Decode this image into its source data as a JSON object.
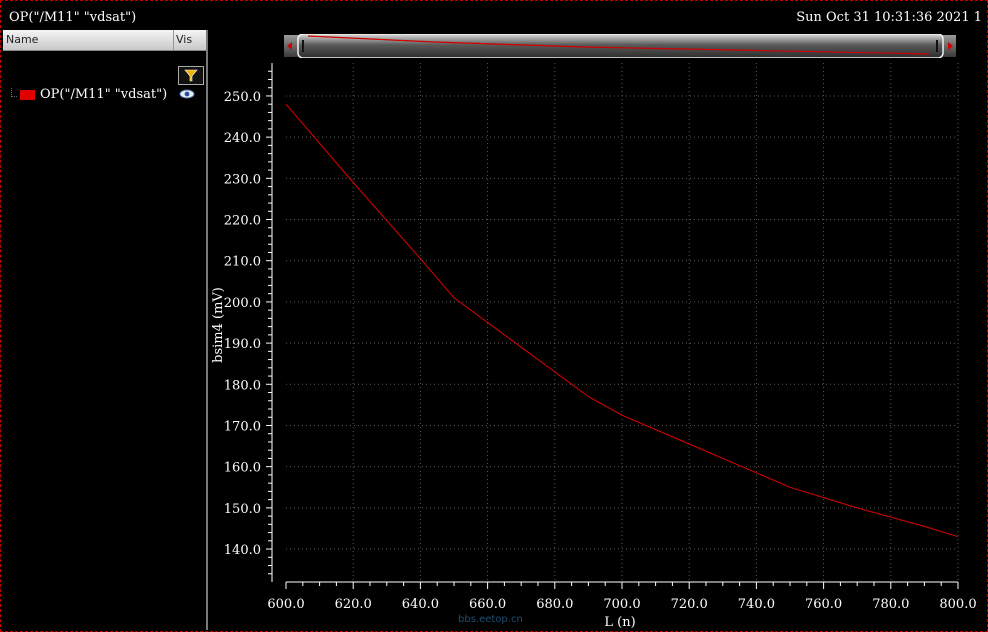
{
  "window": {
    "title": "OP(\"/M11\" \"vdsat\")",
    "datetime": "Sun Oct 31 10:31:36 2021  1"
  },
  "panel": {
    "col_name": "Name",
    "col_vis": "Vis",
    "trace_label": "OP(\"/M11\" \"vdsat\")",
    "trace_color": "#e00000"
  },
  "icons": {
    "filter": "filter-icon",
    "visibility": "eye-icon",
    "scroll_left": "arrow-left-icon",
    "scroll_right": "arrow-right-icon"
  },
  "watermark": "bbs.eetop.cn",
  "chart_data": {
    "type": "line",
    "xlabel": "L (n)",
    "ylabel": "bsim4 (mV)",
    "xlim": [
      600,
      800
    ],
    "ylim": [
      132,
      258
    ],
    "xticks": [
      "600.0",
      "620.0",
      "640.0",
      "660.0",
      "680.0",
      "700.0",
      "720.0",
      "740.0",
      "760.0",
      "780.0",
      "800.0"
    ],
    "yticks": [
      "140.0",
      "150.0",
      "160.0",
      "170.0",
      "180.0",
      "190.0",
      "200.0",
      "210.0",
      "220.0",
      "230.0",
      "240.0",
      "250.0"
    ],
    "grid": true,
    "series": [
      {
        "color": "#e00000",
        "x": [
          600,
          620,
          640,
          650,
          670,
          690,
          700,
          720,
          740,
          750,
          770,
          790,
          800
        ],
        "y": [
          248.0,
          229.0,
          210.5,
          201.0,
          189.0,
          177.0,
          172.5,
          165.5,
          158.5,
          155.0,
          150.0,
          145.5,
          143.0
        ]
      }
    ]
  }
}
